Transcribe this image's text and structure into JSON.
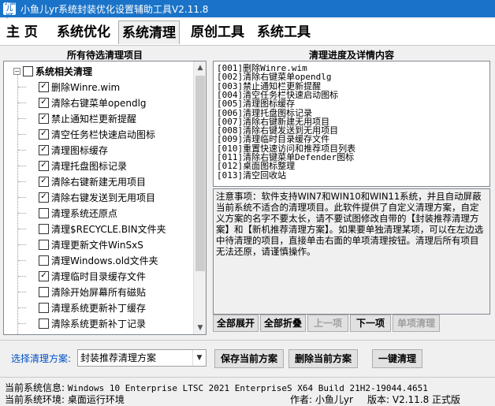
{
  "window": {
    "title": "小鱼儿yr系统封装优化设置辅助工具V2.11.8"
  },
  "menu": {
    "tabs": [
      "主 页",
      "系统优化",
      "系统清理",
      "原创工具",
      "系统工具"
    ]
  },
  "left_panel": {
    "header": "所有待选清理项目",
    "root": {
      "label": "系统相关清理",
      "checked": false,
      "expander": "−"
    },
    "items": [
      {
        "label": "删除Winre.wim",
        "checked": true
      },
      {
        "label": "清除右键菜单opendlg",
        "checked": true
      },
      {
        "label": "禁止通知栏更新提醒",
        "checked": true
      },
      {
        "label": "清空任务栏快速启动图标",
        "checked": true
      },
      {
        "label": "清理图标缓存",
        "checked": true
      },
      {
        "label": "清理托盘图标记录",
        "checked": true
      },
      {
        "label": "清除右键新建无用项目",
        "checked": true
      },
      {
        "label": "清除右键发送到无用项目",
        "checked": true
      },
      {
        "label": "清理系统还原点",
        "checked": false
      },
      {
        "label": "清理$RECYCLE.BIN文件夹",
        "checked": false
      },
      {
        "label": "清理更新文件WinSxS",
        "checked": false
      },
      {
        "label": "清理Windows.old文件夹",
        "checked": false
      },
      {
        "label": "清理临时目录缓存文件",
        "checked": true
      },
      {
        "label": "清除开始屏幕所有磁贴",
        "checked": false
      },
      {
        "label": "清理系统更新补丁缓存",
        "checked": false
      },
      {
        "label": "清除系统更新补丁记录",
        "checked": false
      }
    ]
  },
  "right_panel": {
    "header": "清理进度及详情内容",
    "list": [
      "[001]删除Winre.wim",
      "[002]清除右键菜单opendlg",
      "[003]禁止通知栏更新提醒",
      "[004]清空任务栏快速启动图标",
      "[005]清理图标缓存",
      "[006]清理托盘图标记录",
      "[007]清除右键新建无用项目",
      "[008]清除右键发送到无用项目",
      "[009]清理临时目录缓存文件",
      "[010]重置快速访问和推荐项目列表",
      "[011]清除右键菜单Defender图标",
      "[012]桌面图标整理",
      "[013]清空回收站"
    ],
    "note": "注意事项：软件支持WIN7和WIN10和WIN11系统，并且自动屏蔽当前系统不适合的清理项目。此软件提供了自定义清理方案，自定义方案的名字不要太长，请不要试图修改自带的【封装推荐清理方案】和【新机推荐清理方案】。如果要单独清理某项，可以在左边选中待清理的项目，直接单击右面的单项清理按钮。清理后所有项目无法还原，请谨慎操作。",
    "buttons": {
      "expand_all": "全部展开",
      "collapse_all": "全部折叠",
      "prev": "上一项",
      "next": "下一项",
      "single_clean": "单项清理"
    }
  },
  "bottom": {
    "scheme_label": "选择清理方案:",
    "scheme_value": "封装推荐清理方案",
    "save_btn": "保存当前方案",
    "delete_btn": "删除当前方案",
    "one_click_btn": "一键清理"
  },
  "status": {
    "sysinfo_label": "当前系统信息:",
    "sysinfo_value": "Windows 10 Enterprise LTSC 2021 EnterpriseS X64 Build 21H2-19044.4651",
    "env_label": "当前系统环境:",
    "env_value": "桌面运行环境",
    "author": "作者: 小鱼儿yr",
    "version": "版本: V2.11.8 正式版"
  },
  "colors": {
    "titlebar": "#1a73c8",
    "scheme_label": "#0050c8"
  },
  "icons": {
    "check": "✓",
    "arrow_up": "▲",
    "arrow_down": "▼",
    "dropdown": "▼"
  }
}
